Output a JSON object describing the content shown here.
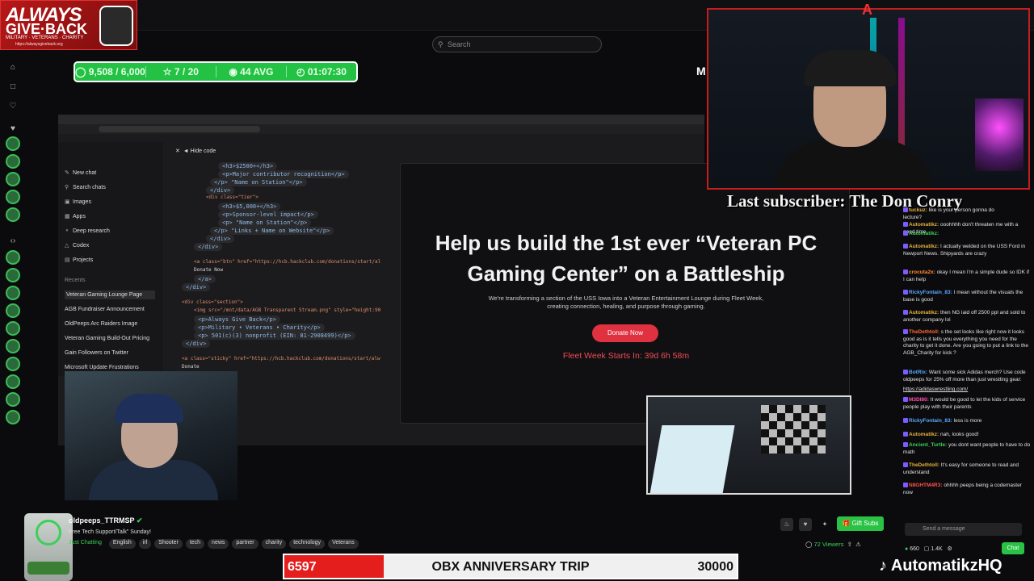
{
  "logo": {
    "line1": "ALWAYS",
    "line2": "GIVE·BACK",
    "line3": "MILITARY · VETERANS · CHARITY",
    "line4": "https://alwaysgiveback.org"
  },
  "search": {
    "placeholder": "Search"
  },
  "stats": {
    "xp": "9,508 / 6,000",
    "stars": "7 / 20",
    "avg": "44 AVG",
    "time": "01:07:30"
  },
  "overlay_letters": {
    "m": "M",
    "a": "A"
  },
  "browser": {
    "hide_code": "Hide code",
    "sidebar": {
      "items": [
        "New chat",
        "Search chats",
        "Images",
        "Apps",
        "Deep research",
        "Codex",
        "Projects"
      ],
      "recents_label": "Recents",
      "recents": [
        "Veteran Gaming Lounge Page",
        "AGB Fundraiser Announcement",
        "OldPeeps Arc Raiders Image",
        "Veteran Gaming Build-Out Pricing",
        "Gain Followers on Twitter",
        "Microsoft Update Frustrations"
      ]
    },
    "code_lines": [
      "<h3>$2500+</h3>",
      "<p>Major contributor recognition</p>",
      "</p> \"Name on Station\"</p>",
      "</div>",
      "<div class=\"tier\">",
      "<h3>$5,000+</h3>",
      "<p>Sponsor-level impact</p>",
      "<p> \"Name on Station\"</p>",
      "</p> \"Links + Name on Website\"</p>",
      "</div>",
      "</div>",
      "<a class=\"btn\" href=\"https://hcb.hackclub.com/donations/start/al",
      "Donate Now",
      "</a>",
      "</div>",
      "<div class=\"section\">",
      "<img src=\"/mnt/data/AGB Transparent Stream.png\" style=\"height:90",
      "<p>Always Give Back</p>",
      "<p>Military • Veterans • Charity</p>",
      "<p> 501(c)(3) nonprofit (EIN: 81-2908499)</p>",
      "</div>",
      "<a class=\"sticky\" href=\"https://hcb.hackclub.com/donations/start/alw",
      "Donate"
    ]
  },
  "preview": {
    "headline": "Help us build the 1st ever “Veteran PC Gaming Center” on a Battleship",
    "subhead": "We're transforming a section of the USS Iowa into a Veteran Entertainment Lounge during Fleet Week, creating connection, healing, and purpose through gaming.",
    "button": "Donate Now",
    "countdown": "Fleet Week Starts In: 39d 6h 58m"
  },
  "subscriber_banner": "Last subscriber: The Don  Conry",
  "chat": {
    "messages": [
      {
        "user": "tuckuz:",
        "text": "like is your person gonna do"
      },
      {
        "user": "",
        "text": "lecture?"
      },
      {
        "user": "Automatikz:",
        "text": "ooohhhh don't threaten me with a good time"
      },
      {
        "user": "Automatikz:",
        "text": ""
      },
      {
        "user": "Automatikz:",
        "text": "I actually welded on the USS Ford in Newport News. Shipyards are crazy"
      },
      {
        "user": "crocuta2x:",
        "text": "okay I mean I'm a simple dude so IDK if I can help"
      },
      {
        "user": "RickyFontain_83:",
        "text": "I mean without the visuals the base is good"
      },
      {
        "user": "Automatikz:",
        "text": "then NG laid off 2500 ppl and sold to another company lol"
      },
      {
        "user": "TheDethtoll:",
        "text": "s the set looks like right now it looks good as is it tells you everything you need for the charity to get it done. Are you going to put a link to the AGB_Charity for kick ?"
      },
      {
        "user": "BotRix:",
        "text": "Want some sick Adidas merch? Use code oldpeeps for 25% off more than just wrestling gear:"
      },
      {
        "user": "",
        "text": "https://adidaswrestling.com/"
      },
      {
        "user": "M3DI80:",
        "text": "It would be good to let the kids of service people play with their parents"
      },
      {
        "user": "RickyFontain_83:",
        "text": "less is more"
      },
      {
        "user": "Automatikz:",
        "text": "nah, looks good!"
      },
      {
        "user": "Ancient_Turtle:",
        "text": "you dont want people to have to do math"
      },
      {
        "user": "TheDethtoll:",
        "text": "It's easy for someone to read and understand"
      },
      {
        "user": "N8GHTM4R3:",
        "text": "ohhhh peeps being a codemaster now"
      }
    ],
    "input_placeholder": "Send a message",
    "chat_button": "Chat",
    "viewer_points": "660",
    "followers": "1.4K"
  },
  "channel": {
    "name": "oldpeeps_TTRMSP",
    "title": "Free Tech Support/Talk\" Sunday!",
    "category": "Just Chatting",
    "tags": [
      "English",
      "irl",
      "Shooter",
      "tech",
      "news",
      "partner",
      "charity",
      "technology",
      "Veterans"
    ],
    "gift_button": "Gift Subs",
    "viewers": "72 Viewers"
  },
  "goal": {
    "current": "6597",
    "label": "OBX ANNIVERSARY TRIP",
    "target": "30000",
    "progress": 0.22
  },
  "tiktok_handle": "AutomatikzHQ",
  "colors": {
    "accent_green": "#29c244",
    "goal_red": "#e41d1d",
    "donate_red": "#e03140",
    "countdown_red": "#ef4a56"
  }
}
